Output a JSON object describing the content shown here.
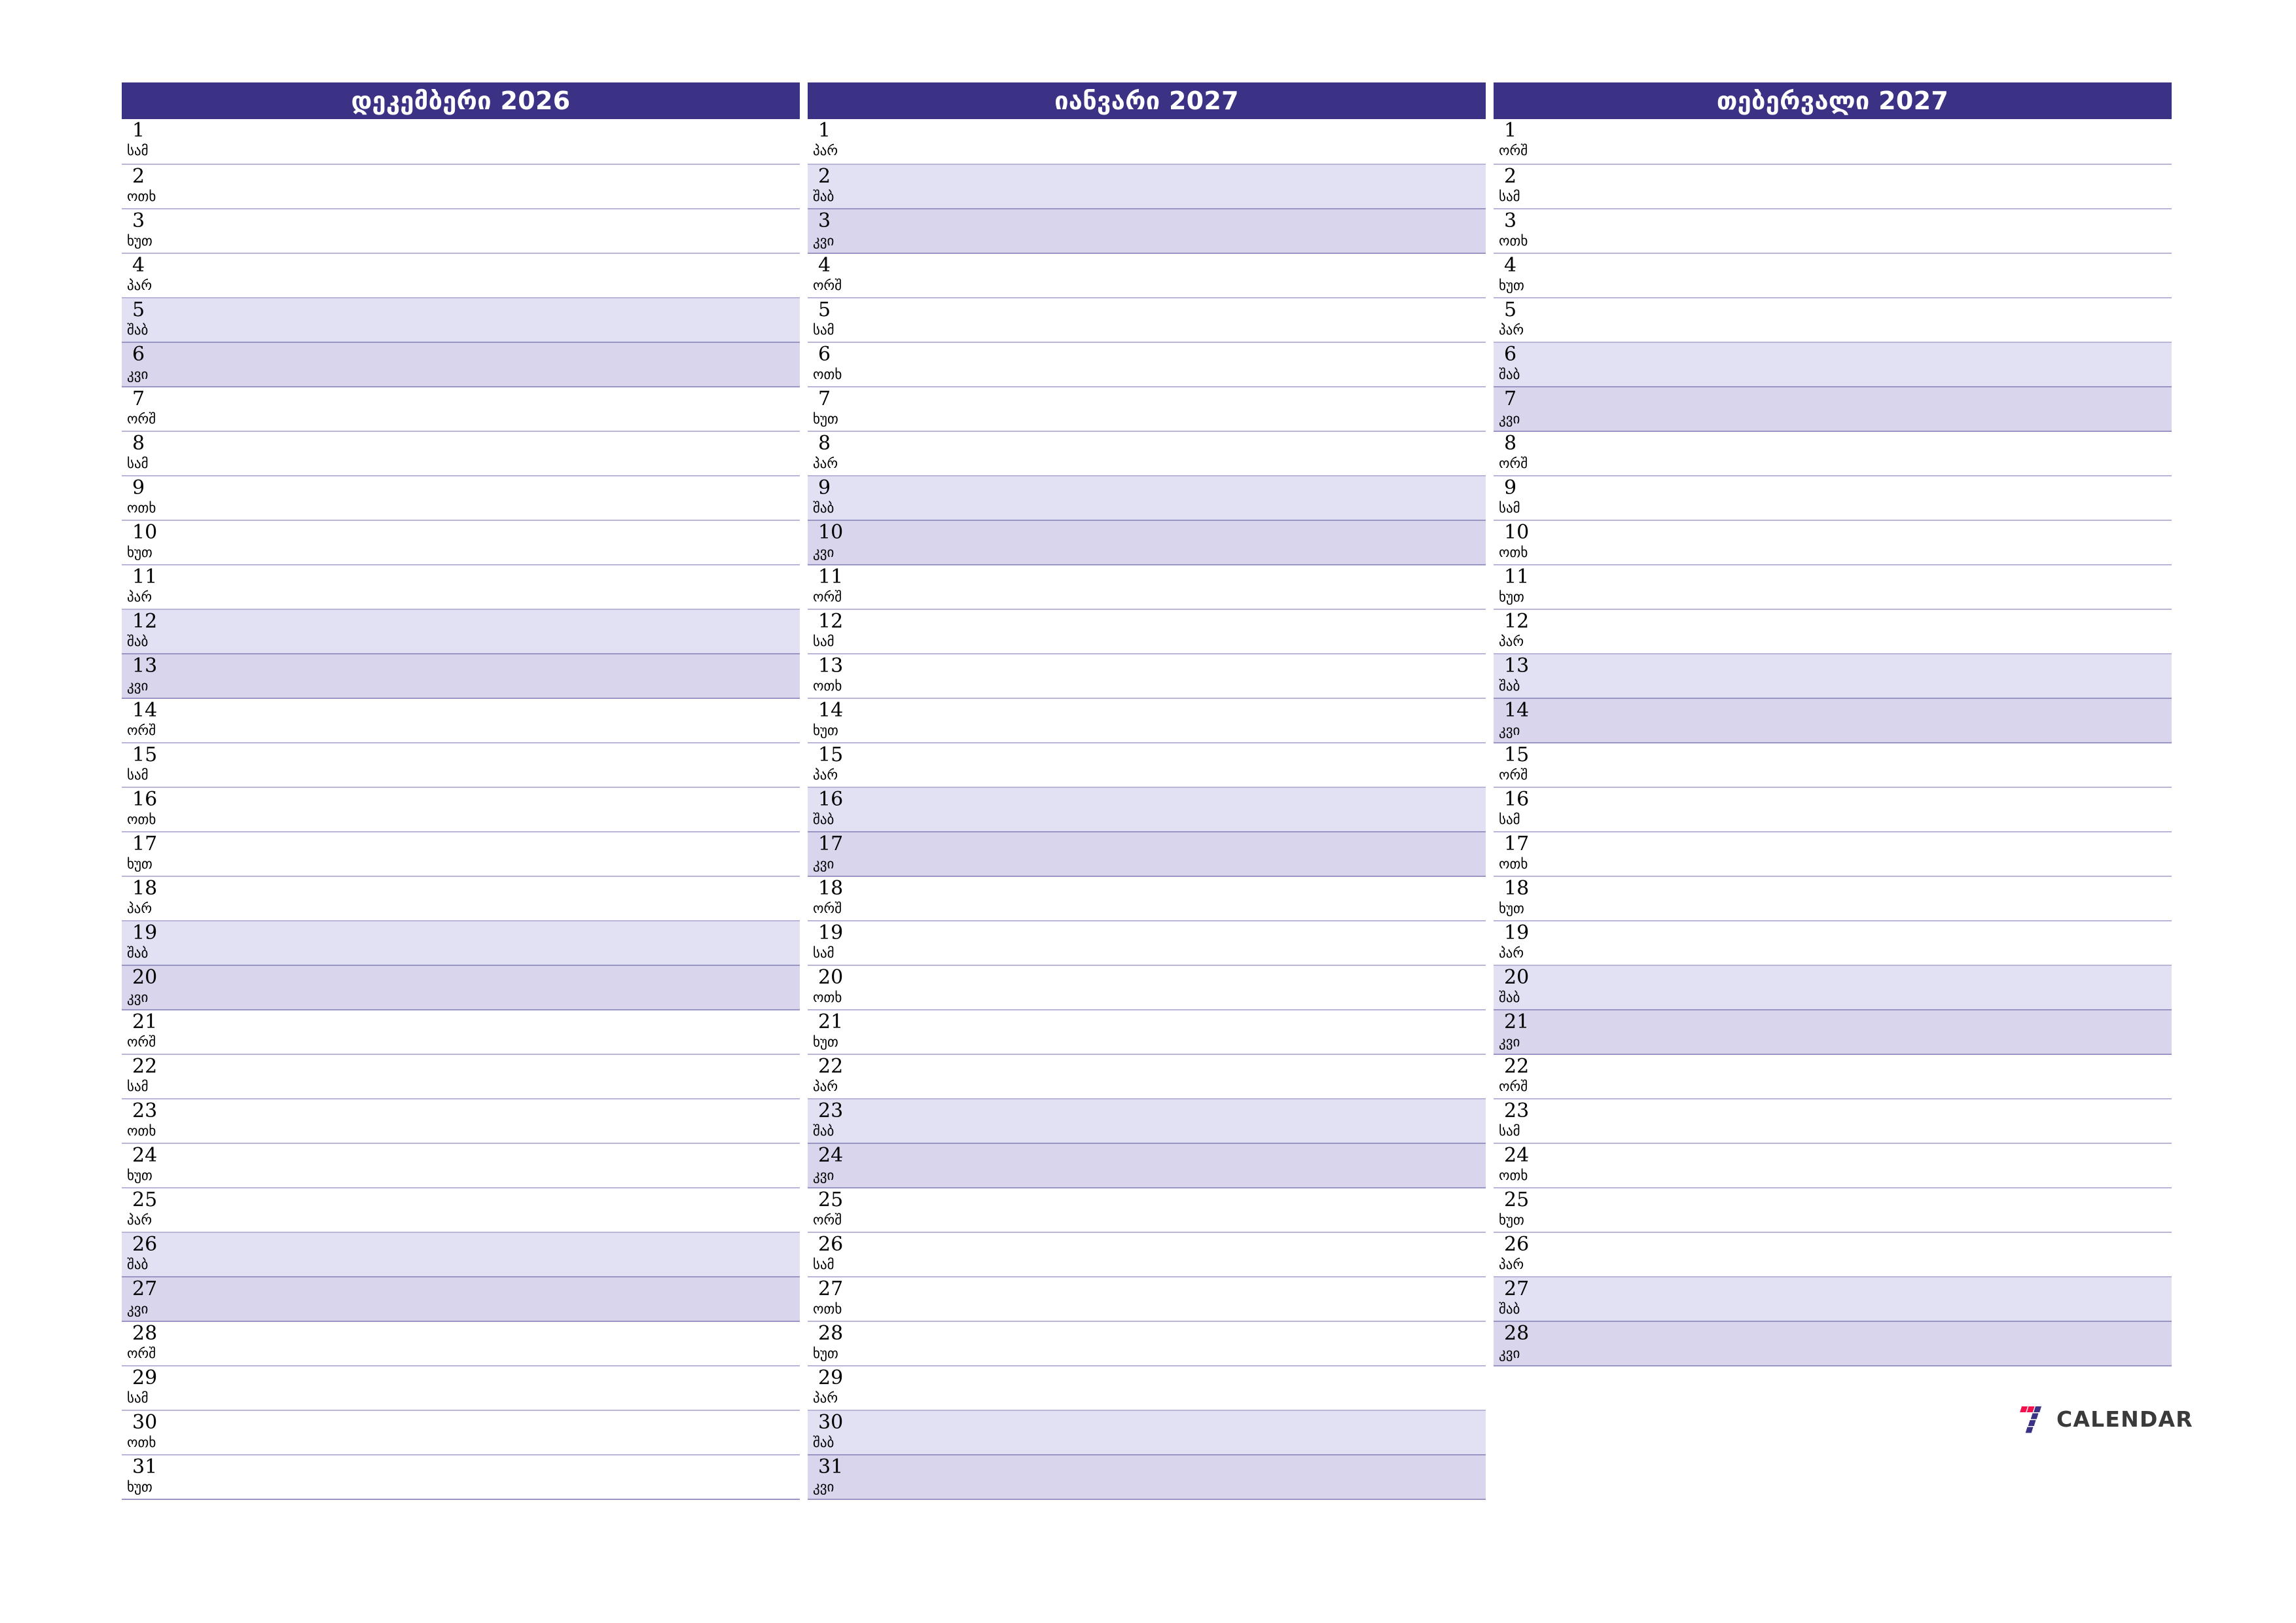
{
  "colors": {
    "header_bg": "#3b3185",
    "header_text": "#ffffff",
    "saturday_bg": "#e2e1f4",
    "sunday_bg": "#d9d5ec",
    "row_border": "#b9b6d8",
    "logo_red": "#f4124c",
    "logo_blue": "#3b3185",
    "logo_text": "#3a3a3a",
    "page_bg": "#ffffff"
  },
  "brand": {
    "mark": "seven-logo-icon",
    "text": "CALENDAR"
  },
  "weekday_abbr": {
    "mon": "ორშ",
    "tue": "სამ",
    "wed": "ოთხ",
    "thu": "ხუთ",
    "fri": "პარ",
    "sat": "შაბ",
    "sun": "კვი"
  },
  "months": [
    {
      "title": "დეკემბერი 2026",
      "days": [
        {
          "n": "1",
          "w": "სამ",
          "t": "wd"
        },
        {
          "n": "2",
          "w": "ოთხ",
          "t": "wd"
        },
        {
          "n": "3",
          "w": "ხუთ",
          "t": "wd"
        },
        {
          "n": "4",
          "w": "პარ",
          "t": "wd"
        },
        {
          "n": "5",
          "w": "შაბ",
          "t": "sat"
        },
        {
          "n": "6",
          "w": "კვი",
          "t": "sun"
        },
        {
          "n": "7",
          "w": "ორშ",
          "t": "wd"
        },
        {
          "n": "8",
          "w": "სამ",
          "t": "wd"
        },
        {
          "n": "9",
          "w": "ოთხ",
          "t": "wd"
        },
        {
          "n": "10",
          "w": "ხუთ",
          "t": "wd"
        },
        {
          "n": "11",
          "w": "პარ",
          "t": "wd"
        },
        {
          "n": "12",
          "w": "შაბ",
          "t": "sat"
        },
        {
          "n": "13",
          "w": "კვი",
          "t": "sun"
        },
        {
          "n": "14",
          "w": "ორშ",
          "t": "wd"
        },
        {
          "n": "15",
          "w": "სამ",
          "t": "wd"
        },
        {
          "n": "16",
          "w": "ოთხ",
          "t": "wd"
        },
        {
          "n": "17",
          "w": "ხუთ",
          "t": "wd"
        },
        {
          "n": "18",
          "w": "პარ",
          "t": "wd"
        },
        {
          "n": "19",
          "w": "შაბ",
          "t": "sat"
        },
        {
          "n": "20",
          "w": "კვი",
          "t": "sun"
        },
        {
          "n": "21",
          "w": "ორშ",
          "t": "wd"
        },
        {
          "n": "22",
          "w": "სამ",
          "t": "wd"
        },
        {
          "n": "23",
          "w": "ოთხ",
          "t": "wd"
        },
        {
          "n": "24",
          "w": "ხუთ",
          "t": "wd"
        },
        {
          "n": "25",
          "w": "პარ",
          "t": "wd"
        },
        {
          "n": "26",
          "w": "შაბ",
          "t": "sat"
        },
        {
          "n": "27",
          "w": "კვი",
          "t": "sun"
        },
        {
          "n": "28",
          "w": "ორშ",
          "t": "wd"
        },
        {
          "n": "29",
          "w": "სამ",
          "t": "wd"
        },
        {
          "n": "30",
          "w": "ოთხ",
          "t": "wd"
        },
        {
          "n": "31",
          "w": "ხუთ",
          "t": "wd"
        }
      ]
    },
    {
      "title": "იანვარი 2027",
      "days": [
        {
          "n": "1",
          "w": "პარ",
          "t": "wd"
        },
        {
          "n": "2",
          "w": "შაბ",
          "t": "sat"
        },
        {
          "n": "3",
          "w": "კვი",
          "t": "sun"
        },
        {
          "n": "4",
          "w": "ორშ",
          "t": "wd"
        },
        {
          "n": "5",
          "w": "სამ",
          "t": "wd"
        },
        {
          "n": "6",
          "w": "ოთხ",
          "t": "wd"
        },
        {
          "n": "7",
          "w": "ხუთ",
          "t": "wd"
        },
        {
          "n": "8",
          "w": "პარ",
          "t": "wd"
        },
        {
          "n": "9",
          "w": "შაბ",
          "t": "sat"
        },
        {
          "n": "10",
          "w": "კვი",
          "t": "sun"
        },
        {
          "n": "11",
          "w": "ორშ",
          "t": "wd"
        },
        {
          "n": "12",
          "w": "სამ",
          "t": "wd"
        },
        {
          "n": "13",
          "w": "ოთხ",
          "t": "wd"
        },
        {
          "n": "14",
          "w": "ხუთ",
          "t": "wd"
        },
        {
          "n": "15",
          "w": "პარ",
          "t": "wd"
        },
        {
          "n": "16",
          "w": "შაბ",
          "t": "sat"
        },
        {
          "n": "17",
          "w": "კვი",
          "t": "sun"
        },
        {
          "n": "18",
          "w": "ორშ",
          "t": "wd"
        },
        {
          "n": "19",
          "w": "სამ",
          "t": "wd"
        },
        {
          "n": "20",
          "w": "ოთხ",
          "t": "wd"
        },
        {
          "n": "21",
          "w": "ხუთ",
          "t": "wd"
        },
        {
          "n": "22",
          "w": "პარ",
          "t": "wd"
        },
        {
          "n": "23",
          "w": "შაბ",
          "t": "sat"
        },
        {
          "n": "24",
          "w": "კვი",
          "t": "sun"
        },
        {
          "n": "25",
          "w": "ორშ",
          "t": "wd"
        },
        {
          "n": "26",
          "w": "სამ",
          "t": "wd"
        },
        {
          "n": "27",
          "w": "ოთხ",
          "t": "wd"
        },
        {
          "n": "28",
          "w": "ხუთ",
          "t": "wd"
        },
        {
          "n": "29",
          "w": "პარ",
          "t": "wd"
        },
        {
          "n": "30",
          "w": "შაბ",
          "t": "sat"
        },
        {
          "n": "31",
          "w": "კვი",
          "t": "sun"
        }
      ]
    },
    {
      "title": "თებერვალი 2027",
      "days": [
        {
          "n": "1",
          "w": "ორშ",
          "t": "wd"
        },
        {
          "n": "2",
          "w": "სამ",
          "t": "wd"
        },
        {
          "n": "3",
          "w": "ოთხ",
          "t": "wd"
        },
        {
          "n": "4",
          "w": "ხუთ",
          "t": "wd"
        },
        {
          "n": "5",
          "w": "პარ",
          "t": "wd"
        },
        {
          "n": "6",
          "w": "შაბ",
          "t": "sat"
        },
        {
          "n": "7",
          "w": "კვი",
          "t": "sun"
        },
        {
          "n": "8",
          "w": "ორშ",
          "t": "wd"
        },
        {
          "n": "9",
          "w": "სამ",
          "t": "wd"
        },
        {
          "n": "10",
          "w": "ოთხ",
          "t": "wd"
        },
        {
          "n": "11",
          "w": "ხუთ",
          "t": "wd"
        },
        {
          "n": "12",
          "w": "პარ",
          "t": "wd"
        },
        {
          "n": "13",
          "w": "შაბ",
          "t": "sat"
        },
        {
          "n": "14",
          "w": "კვი",
          "t": "sun"
        },
        {
          "n": "15",
          "w": "ორშ",
          "t": "wd"
        },
        {
          "n": "16",
          "w": "სამ",
          "t": "wd"
        },
        {
          "n": "17",
          "w": "ოთხ",
          "t": "wd"
        },
        {
          "n": "18",
          "w": "ხუთ",
          "t": "wd"
        },
        {
          "n": "19",
          "w": "პარ",
          "t": "wd"
        },
        {
          "n": "20",
          "w": "შაბ",
          "t": "sat"
        },
        {
          "n": "21",
          "w": "კვი",
          "t": "sun"
        },
        {
          "n": "22",
          "w": "ორშ",
          "t": "wd"
        },
        {
          "n": "23",
          "w": "სამ",
          "t": "wd"
        },
        {
          "n": "24",
          "w": "ოთხ",
          "t": "wd"
        },
        {
          "n": "25",
          "w": "ხუთ",
          "t": "wd"
        },
        {
          "n": "26",
          "w": "პარ",
          "t": "wd"
        },
        {
          "n": "27",
          "w": "შაბ",
          "t": "sat"
        },
        {
          "n": "28",
          "w": "კვი",
          "t": "sun"
        }
      ]
    }
  ]
}
